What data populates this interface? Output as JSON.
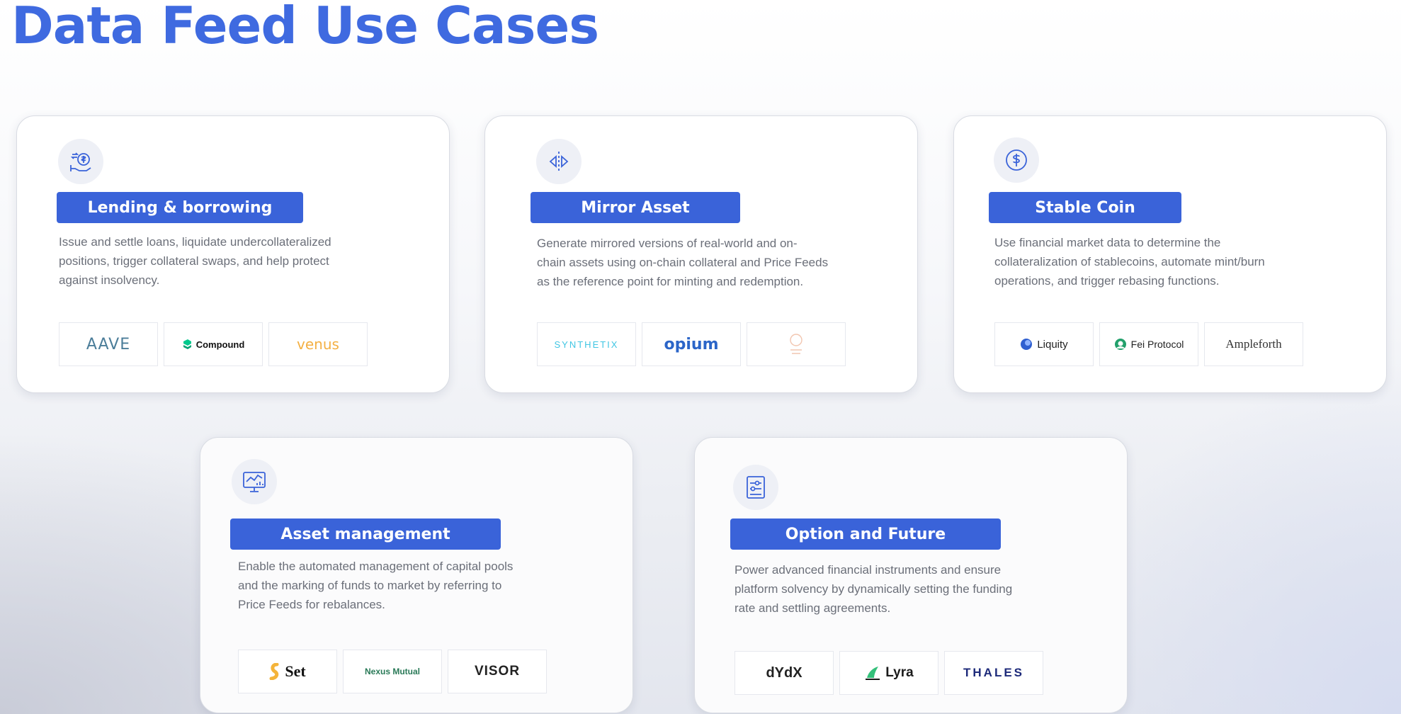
{
  "page": {
    "title": "Data Feed Use Cases"
  },
  "cards": [
    {
      "title": "Lending & borrowing",
      "description": [
        "Issue and settle loans, liquidate undercollateralized",
        "positions, trigger collateral swaps, and help protect",
        "against insolvency."
      ],
      "icon": "hand-money-icon",
      "logos": [
        "AAVE",
        "Compound",
        "venus"
      ]
    },
    {
      "title": "Mirror Asset",
      "description": [
        "Generate mirrored versions of real-world and on-",
        "chain assets using on-chain collateral and Price Feeds",
        "as the reference point for minting and redemption."
      ],
      "icon": "mirror-icon",
      "logos": [
        "SYNTHETIX",
        "opium",
        ""
      ]
    },
    {
      "title": "Stable Coin",
      "description": [
        "Use financial market data to determine the",
        "collateralization of stablecoins, automate mint/burn",
        "operations, and trigger rebasing functions."
      ],
      "icon": "dollar-coin-icon",
      "logos": [
        "Liquity",
        "Fei Protocol",
        "Ampleforth"
      ]
    },
    {
      "title": "Asset management",
      "description": [
        "Enable the automated management of capital pools",
        "and the marking of funds to market by referring to",
        "Price Feeds for rebalances."
      ],
      "icon": "monitor-chart-icon",
      "logos": [
        "Set",
        "Nexus Mutual",
        "VISOR"
      ]
    },
    {
      "title": "Option and Future",
      "description": [
        "Power advanced financial instruments and ensure",
        "platform solvency by dynamically setting the funding",
        "rate and settling agreements."
      ],
      "icon": "sliders-icon",
      "logos": [
        "dYdX",
        "Lyra",
        "THALES"
      ]
    }
  ],
  "colors": {
    "accent": "#3a63d9",
    "title": "#3f6ae0"
  }
}
